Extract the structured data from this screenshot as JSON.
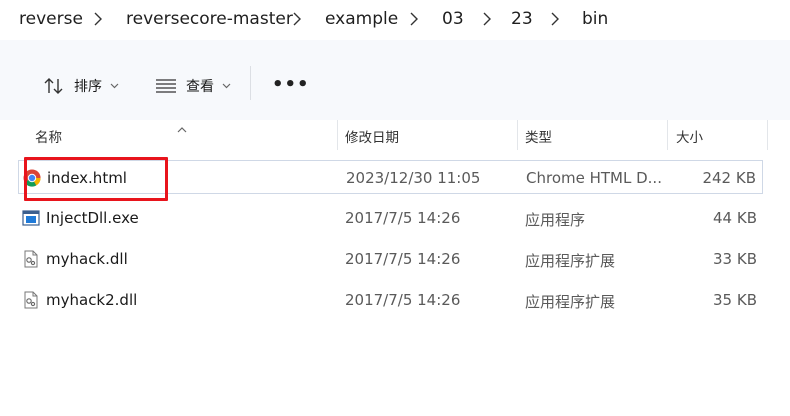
{
  "breadcrumb": [
    "reverse",
    "reversecore-master",
    "example",
    "03",
    "23",
    "bin"
  ],
  "toolbar": {
    "sort_label": "排序",
    "view_label": "查看",
    "more_label": "•••"
  },
  "columns": {
    "name": "名称",
    "date": "修改日期",
    "type": "类型",
    "size": "大小"
  },
  "files": [
    {
      "name": "index.html",
      "date": "2023/12/30 11:05",
      "type": "Chrome HTML D...",
      "size": "242 KB",
      "icon": "chrome-icon"
    },
    {
      "name": "InjectDll.exe",
      "date": "2017/7/5 14:26",
      "type": "应用程序",
      "size": "44 KB",
      "icon": "exe-icon"
    },
    {
      "name": "myhack.dll",
      "date": "2017/7/5 14:26",
      "type": "应用程序扩展",
      "size": "33 KB",
      "icon": "dll-icon"
    },
    {
      "name": "myhack2.dll",
      "date": "2017/7/5 14:26",
      "type": "应用程序扩展",
      "size": "35 KB",
      "icon": "dll-icon"
    }
  ],
  "colors": {
    "highlight": "#e8141c",
    "selection_border": "#cfd8e6"
  }
}
